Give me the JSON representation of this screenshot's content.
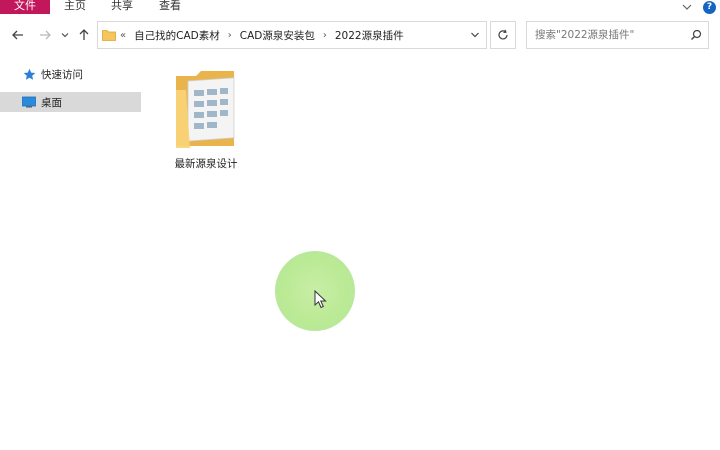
{
  "ribbon": {
    "tabs": {
      "file": "文件",
      "home": "主页",
      "share": "共享",
      "view": "查看"
    }
  },
  "address": {
    "overflow": "«",
    "crumbs": [
      "自己找的CAD素材",
      "CAD源泉安装包",
      "2022源泉插件"
    ]
  },
  "search": {
    "placeholder": "搜索\"2022源泉插件\""
  },
  "sidebar": {
    "items": [
      {
        "label": "快速访问",
        "icon": "star-icon",
        "selected": false
      },
      {
        "label": "桌面",
        "icon": "desktop-icon",
        "selected": true
      }
    ]
  },
  "content": {
    "items": [
      {
        "name": "最新源泉设计",
        "icon": "folder-icon"
      }
    ]
  },
  "colors": {
    "file_tab": "#c2185b",
    "selection": "#d9d9d9",
    "click_highlight": "#b5e68f",
    "folder": "#f5c65b"
  }
}
